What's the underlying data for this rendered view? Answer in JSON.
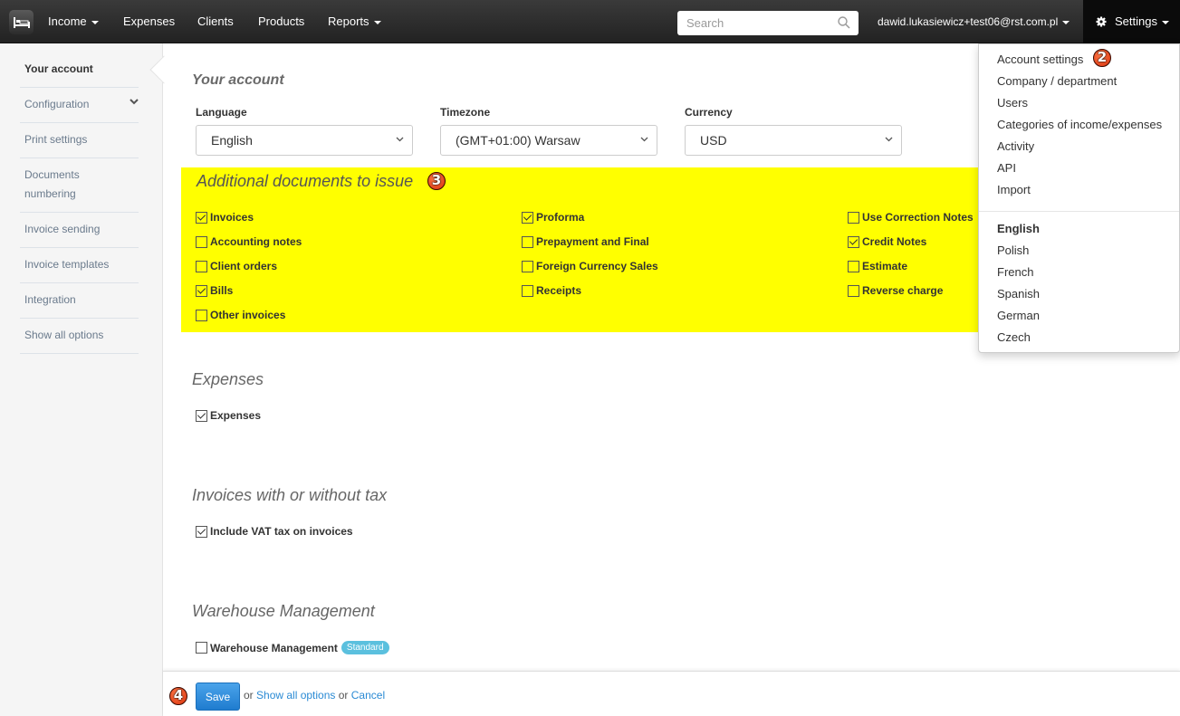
{
  "navbar": {
    "logo_icon": "bed-icon",
    "items": [
      {
        "label": "Income",
        "has_caret": true
      },
      {
        "label": "Expenses",
        "has_caret": false
      },
      {
        "label": "Clients",
        "has_caret": false
      },
      {
        "label": "Products",
        "has_caret": false
      },
      {
        "label": "Reports",
        "has_caret": true
      }
    ],
    "search_placeholder": "Search",
    "search_value": "",
    "user_email": "dawid.lukasiewicz+test06@rst.com.pl",
    "settings_label": "Settings"
  },
  "sidebar": {
    "items": [
      {
        "label": "Your account",
        "active": true
      },
      {
        "label": "Configuration",
        "expandable": true
      },
      {
        "label": "Print settings"
      },
      {
        "label": "Documents numbering"
      },
      {
        "label": "Invoice sending"
      },
      {
        "label": "Invoice templates"
      },
      {
        "label": "Integration"
      },
      {
        "label": "Show all options"
      }
    ]
  },
  "main": {
    "your_account": {
      "title": "Your account",
      "language_label": "Language",
      "language_value": "English",
      "timezone_label": "Timezone",
      "timezone_value": "(GMT+01:00) Warsaw",
      "currency_label": "Currency",
      "currency_value": "USD"
    },
    "additional_docs": {
      "title": "Additional documents to issue",
      "marker": "3",
      "highlight_color": "#ffff00",
      "columns": [
        [
          {
            "label": "Invoices",
            "checked": true
          },
          {
            "label": "Accounting notes",
            "checked": false
          },
          {
            "label": "Client orders",
            "checked": false
          },
          {
            "label": "Bills",
            "checked": true
          },
          {
            "label": "Other invoices",
            "checked": false
          }
        ],
        [
          {
            "label": "Proforma",
            "checked": true
          },
          {
            "label": "Prepayment and Final",
            "checked": false
          },
          {
            "label": "Foreign Currency Sales",
            "checked": false
          },
          {
            "label": "Receipts",
            "checked": false
          }
        ],
        [
          {
            "label": "Use Correction Notes",
            "checked": false
          },
          {
            "label": "Credit Notes",
            "checked": true
          },
          {
            "label": "Estimate",
            "checked": false
          },
          {
            "label": "Reverse charge",
            "checked": false
          }
        ]
      ]
    },
    "expenses": {
      "title": "Expenses",
      "option": {
        "label": "Expenses",
        "checked": true
      }
    },
    "tax": {
      "title": "Invoices with or without tax",
      "option": {
        "label": "Include VAT tax on invoices",
        "checked": true
      }
    },
    "warehouse": {
      "title": "Warehouse Management",
      "option": {
        "label": "Warehouse Management",
        "checked": false
      },
      "badge": "Standard"
    }
  },
  "settings_menu": {
    "marker": "2",
    "items": [
      "Account settings",
      "Company / department",
      "Users",
      "Categories of income/expenses",
      "Activity",
      "API",
      "Import"
    ],
    "languages": [
      {
        "label": "English",
        "current": true
      },
      {
        "label": "Polish"
      },
      {
        "label": "French"
      },
      {
        "label": "Spanish"
      },
      {
        "label": "German"
      },
      {
        "label": "Czech"
      }
    ]
  },
  "footer": {
    "marker": "4",
    "save_label": "Save",
    "or1": "or",
    "show_all_label": "Show all options",
    "or2": "or",
    "cancel_label": "Cancel"
  },
  "colors": {
    "accent": "#2a8ad4",
    "badge": "#5bc0de",
    "marker": "#e0401a"
  }
}
